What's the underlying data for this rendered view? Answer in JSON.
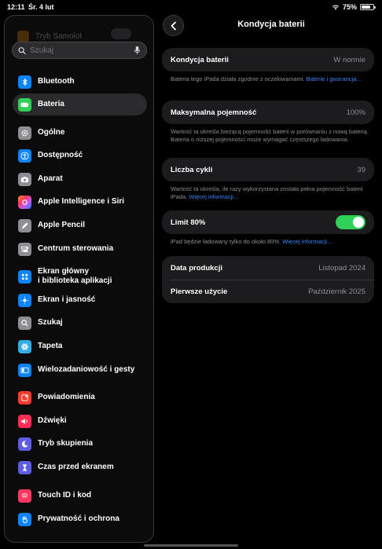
{
  "status": {
    "time": "12:11",
    "date": "Śr. 4 lut",
    "battery": "75%",
    "battery_level": 0.75
  },
  "search": {
    "placeholder": "Szukaj"
  },
  "sidebar": {
    "ghost_item": "Tryb Samolot",
    "items": [
      {
        "label": "Bluetooth",
        "icon": "bluetooth-icon",
        "color": "#0a84ff"
      },
      {
        "label": "Bateria",
        "icon": "battery-icon",
        "color": "#30d158"
      },
      {
        "label": "Ogólne",
        "icon": "gear-icon",
        "color": "#8e8e93"
      },
      {
        "label": "Dostępność",
        "icon": "accessibility-icon",
        "color": "#0a84ff"
      },
      {
        "label": "Aparat",
        "icon": "camera-icon",
        "color": "#8e8e93"
      },
      {
        "label": "Apple Intelligence i Siri",
        "icon": "siri-icon",
        "color": "#bf5af2"
      },
      {
        "label": "Apple Pencil",
        "icon": "pencil-icon",
        "color": "#8e8e93"
      },
      {
        "label": "Centrum sterowania",
        "icon": "control-center-icon",
        "color": "#8e8e93"
      },
      {
        "label": "Ekran główny i biblioteka aplikacji",
        "label_line1": "Ekran główny",
        "label_line2": "i biblioteka aplikacji",
        "icon": "home-screen-icon",
        "color": "#0a84ff"
      },
      {
        "label": "Ekran i jasność",
        "icon": "brightness-icon",
        "color": "#0a84ff"
      },
      {
        "label": "Szukaj",
        "icon": "search-icon",
        "color": "#8e8e93"
      },
      {
        "label": "Tapeta",
        "icon": "wallpaper-icon",
        "color": "#32ade6"
      },
      {
        "label": "Wielozadaniowość i gesty",
        "icon": "multitasking-icon",
        "color": "#0a84ff"
      },
      {
        "label": "Powiadomienia",
        "icon": "notifications-icon",
        "color": "#ff3b30"
      },
      {
        "label": "Dźwięki",
        "icon": "speaker-icon",
        "color": "#ff2d55"
      },
      {
        "label": "Tryb skupienia",
        "icon": "moon-icon",
        "color": "#5e5ce6"
      },
      {
        "label": "Czas przed ekranem",
        "icon": "hourglass-icon",
        "color": "#5e5ce6"
      },
      {
        "label": "Touch ID i kod",
        "icon": "fingerprint-icon",
        "color": "#ff375f"
      },
      {
        "label": "Prywatność i ochrona",
        "icon": "hand-icon",
        "color": "#0a84ff"
      }
    ]
  },
  "main": {
    "title": "Kondycja baterii",
    "health": {
      "label": "Kondycja baterii",
      "value": "W normie"
    },
    "health_note": "Bateria tego iPada działa zgodnie z oczekiwaniami.",
    "health_link": "Baterie i gwarancja...",
    "capacity": {
      "label": "Maksymalna pojemność",
      "value": "100%"
    },
    "capacity_note": "Wartość ta określa bieżącą pojemność baterii w porównaniu z nową baterią. Bateria o niższej pojemności może wymagać częstszego ładowania.",
    "cycles": {
      "label": "Liczba cykli",
      "value": "39"
    },
    "cycles_note": "Wartość ta określa, ile razy wykorzystana została pełna pojemność baterii iPada.",
    "cycles_link": "Więcej informacji...",
    "limit": {
      "label": "Limit 80%",
      "enabled": true
    },
    "limit_note": "iPad będzie ładowany tylko do około 80%.",
    "limit_link": "Więcej informacji...",
    "manufacture": {
      "label": "Data produkcji",
      "value": "Listopad 2024"
    },
    "first_use": {
      "label": "Pierwsze użycie",
      "value": "Październik 2025"
    }
  }
}
